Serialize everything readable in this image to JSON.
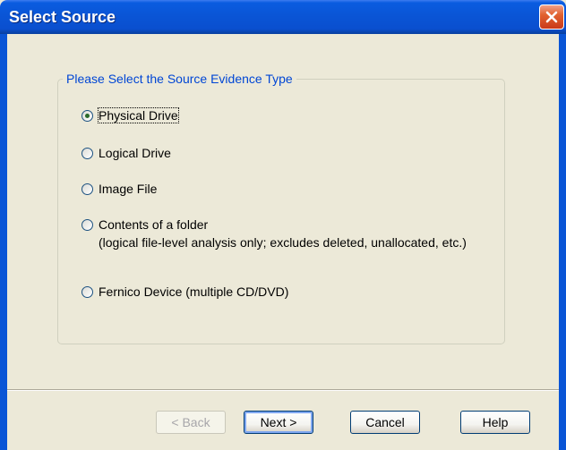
{
  "window": {
    "title": "Select Source",
    "close_icon": "close-icon"
  },
  "group": {
    "legend": "Please Select the Source Evidence Type"
  },
  "options": [
    {
      "label": "Physical Drive",
      "selected": true
    },
    {
      "label": "Logical Drive",
      "selected": false
    },
    {
      "label": "Image File",
      "selected": false
    },
    {
      "label": "Contents of a folder",
      "selected": false
    },
    {
      "label": "Fernico Device (multiple CD/DVD)",
      "selected": false
    }
  ],
  "folder_note": "(logical file-level analysis only; excludes deleted, unallocated, etc.)",
  "buttons": {
    "back": "< Back",
    "next": "Next >",
    "cancel": "Cancel",
    "help": "Help"
  },
  "colors": {
    "titlebar": "#0a55d6",
    "legend_text": "#0046d5",
    "dialog_bg": "#ece9d8",
    "close_button": "#e2622f"
  }
}
